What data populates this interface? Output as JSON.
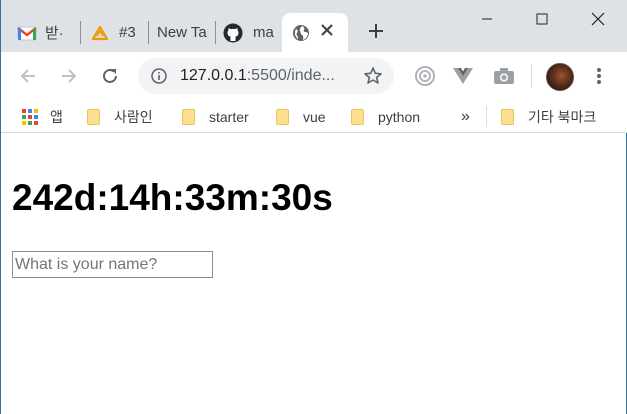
{
  "browser": {
    "tabs": [
      {
        "label": "받·",
        "icon": "gmail-icon",
        "active": false
      },
      {
        "label": "#3",
        "icon": "warning-triangle-icon",
        "active": false
      },
      {
        "label": "New Ta",
        "icon": "",
        "active": false
      },
      {
        "label": "ma",
        "icon": "github-icon",
        "active": false
      },
      {
        "label": "",
        "icon": "globe-icon",
        "active": true
      }
    ],
    "address": {
      "host": "127.0.0.1",
      "rest": ":5500/inde..."
    },
    "bookmarks": {
      "apps_label": "앱",
      "items": [
        "사람인",
        "starter",
        "vue",
        "python"
      ],
      "overflow_label": "»",
      "other_label": "기타 북마크"
    }
  },
  "page": {
    "clock_text": "242d:14h:33m:30s",
    "name_input": {
      "value": "",
      "placeholder": "What is your name?"
    }
  }
}
